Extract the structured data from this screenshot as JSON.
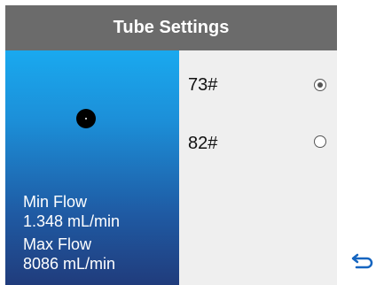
{
  "title": "Tube Settings",
  "flow": {
    "min_label": "Min Flow",
    "min_value": "1.348 mL/min",
    "max_label": "Max Flow",
    "max_value": "8086 mL/min"
  },
  "options": [
    {
      "label": "73#",
      "selected": true
    },
    {
      "label": "82#",
      "selected": false
    }
  ],
  "icons": {
    "back": "back-arrow-icon",
    "tube": "tube-dot-icon"
  },
  "colors": {
    "title_bar": "#6b6b6b",
    "panel_top": "#1aa9ef",
    "panel_bottom": "#203c7c",
    "accent": "#1565c0"
  }
}
